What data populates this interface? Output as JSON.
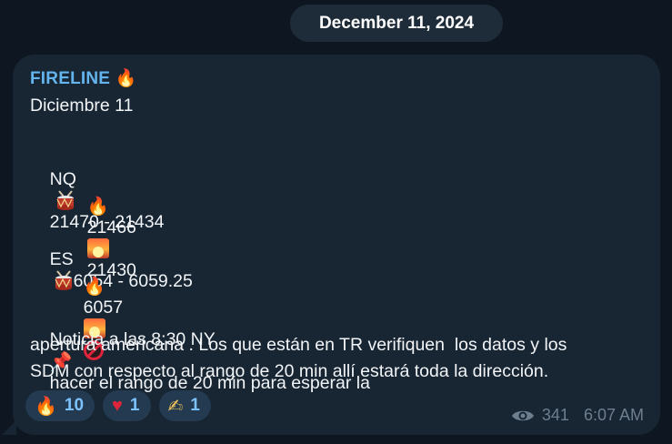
{
  "date_header": "December 11, 2024",
  "message": {
    "sender": "FIRELINE",
    "sender_emoji": "🔥",
    "lines": {
      "date": "Diciembre 11",
      "nq_label": "NQ",
      "nq_range": "21470 - 21434",
      "nq_fire_val": "21466",
      "nq_sunrise_val": "21430",
      "es_label": "ES",
      "es_range": "6054 - 6059.25",
      "es_fire_val": "6057",
      "note_1a": "Noticia a las 8:30 NY",
      "note_1b": "hacer el rango de 20 min para esperar la",
      "note_2": "apertura americana . Los que están en TR verifiquen  los datos y los",
      "note_3": "SDM con respecto al rango de 20 min allí estará toda la dirección."
    },
    "icons": [
      "fire-icon",
      "drum-icon",
      "sunrise-icon",
      "no-entry-icon",
      "pushpin-icon"
    ],
    "reactions": [
      {
        "emoji": "🔥",
        "count": "10",
        "icon": "fire-icon"
      },
      {
        "emoji": "♥",
        "count": "1",
        "icon": "heart-icon"
      },
      {
        "emoji": "✍",
        "count": "1",
        "icon": "writing-hand-icon"
      }
    ],
    "views": "341",
    "time": "6:07 AM"
  },
  "colors": {
    "background": "#0e1621",
    "bubble": "#182533",
    "sender": "#64b5ef",
    "reaction_bg": "#233a50",
    "reaction_text": "#7bc2ff",
    "meta": "#6d7f8f"
  }
}
